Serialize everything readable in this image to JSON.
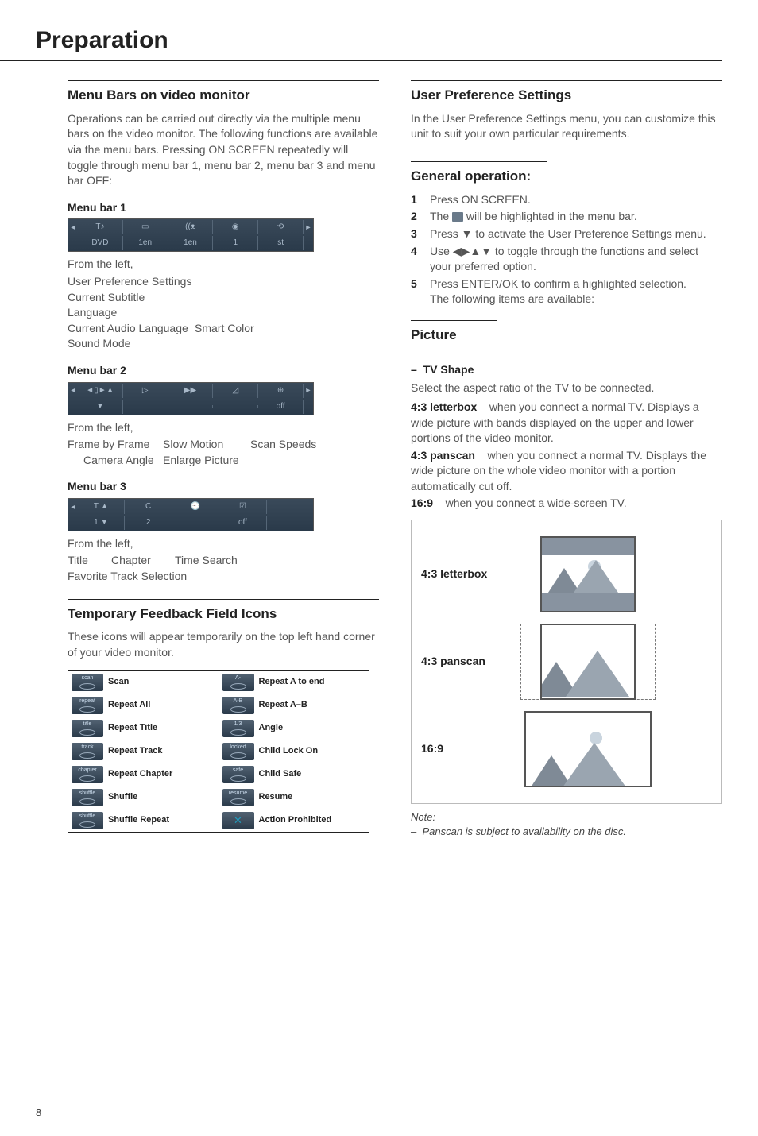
{
  "pageTitle": "Preparation",
  "pageNumber": "8",
  "left": {
    "menuBarsHead": "Menu Bars on video monitor",
    "menuBarsIntro": "Operations can be carried out directly via the multiple menu bars on the video monitor. The following functions are available via the menu bars. Pressing ON SCREEN repeatedly will toggle through menu bar 1, menu bar 2, menu bar 3 and menu bar OFF:",
    "mb1": {
      "title": "Menu bar 1",
      "row1": [
        "T♪",
        "▭",
        "((ᴥ",
        "◉",
        "⟲"
      ],
      "row2": [
        "DVD",
        "1en",
        "1en",
        "1",
        "st"
      ],
      "from": "From the left,",
      "lines": [
        [
          "User Preference Settings",
          ""
        ],
        [
          "Current Subtitle Language",
          ""
        ],
        [
          "Current Audio Language",
          "Smart Color"
        ],
        [
          "Sound Mode",
          ""
        ]
      ]
    },
    "mb2": {
      "title": "Menu bar 2",
      "row1": [
        "◄▯►▲",
        "▷",
        "▶▶",
        "◿",
        "⊕"
      ],
      "row2": [
        "▼",
        "",
        "",
        "",
        "off"
      ],
      "from": "From the left,",
      "lines": [
        [
          "Frame by Frame",
          "Slow Motion",
          "Scan Speeds"
        ],
        [
          "Camera Angle",
          "Enlarge Picture",
          ""
        ]
      ]
    },
    "mb3": {
      "title": "Menu bar 3",
      "row1": [
        "T ▲",
        "C",
        "🕘",
        "☑",
        ""
      ],
      "row2": [
        "1 ▼",
        "2",
        "",
        "off",
        ""
      ],
      "from": "From the left,",
      "lines": [
        [
          "Title",
          "Chapter",
          "Time Search"
        ],
        [
          "Favorite Track Selection",
          "",
          ""
        ]
      ]
    },
    "tempHead": "Temporary Feedback Field Icons",
    "tempIntro": "These icons will appear temporarily on the top left hand corner of your video monitor.",
    "fb": [
      {
        "l": "scan",
        "lLabel": "Scan",
        "r": "A-",
        "rLabel": "Repeat A to end"
      },
      {
        "l": "repeat",
        "lLabel": "Repeat All",
        "r": "A-B",
        "rLabel": "Repeat A–B"
      },
      {
        "l": "title",
        "lLabel": "Repeat Title",
        "r": "1/3",
        "rLabel": "Angle"
      },
      {
        "l": "track",
        "lLabel": "Repeat Track",
        "r": "locked",
        "rLabel": "Child Lock On"
      },
      {
        "l": "chapter",
        "lLabel": "Repeat Chapter",
        "r": "safe",
        "rLabel": "Child Safe"
      },
      {
        "l": "shuffle",
        "lLabel": "Shuffle",
        "r": "resume",
        "rLabel": "Resume"
      },
      {
        "l": "shuffle",
        "lLabel": "Shuffle Repeat",
        "r": "",
        "rLabel": "Action Prohibited",
        "rProhibit": true
      }
    ]
  },
  "right": {
    "prefHead": "User Preference Settings",
    "prefIntro": "In the User Preference Settings menu, you can customize this unit to suit your own particular requirements.",
    "genHead": "General operation:",
    "steps": [
      "Press ON SCREEN.",
      "The [icon] will be highlighted in the menu bar.",
      "Press ▼ to activate the User Preference Settings menu.",
      "Use ◀▶▲▼ to toggle through the functions and select your preferred option.",
      "Press ENTER/OK to confirm a highlighted selection."
    ],
    "stepsTail": "The following items are available:",
    "pictureHead": "Picture",
    "tvShape": {
      "dash": "–",
      "title": "TV Shape",
      "intro": "Select the aspect ratio of the TV to be connected.",
      "opts": [
        {
          "name": "4:3 letterbox",
          "desc": "when you connect a normal TV. Displays a wide picture with bands displayed on the upper and lower portions of the video monitor."
        },
        {
          "name": "4:3 panscan",
          "desc": "when you connect a normal TV. Displays the wide picture on the whole video monitor with a portion automatically cut off."
        },
        {
          "name": "16:9",
          "desc": "when you connect a wide-screen TV."
        }
      ]
    },
    "shapeLabels": [
      "4:3 letterbox",
      "4:3 panscan",
      "16:9"
    ],
    "noteLabel": "Note:",
    "noteText": "Panscan is subject to availability on the disc."
  }
}
